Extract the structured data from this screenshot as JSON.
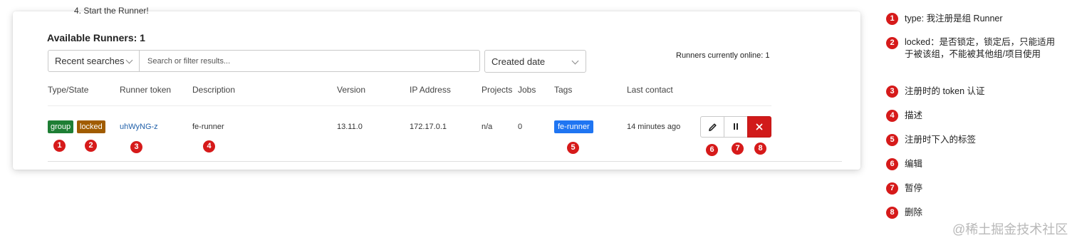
{
  "top_fragment": "4. Start the Runner!",
  "runners_title": "Available Runners: 1",
  "search": {
    "recent_label": "Recent searches",
    "placeholder": "Search or filter results...",
    "sort_label": "Created date"
  },
  "online_text": "Runners currently online: 1",
  "columns": [
    "Type/State",
    "Runner token",
    "Description",
    "Version",
    "IP Address",
    "Projects",
    "Jobs",
    "Tags",
    "Last contact"
  ],
  "runner": {
    "type_badge": "group",
    "state_badge": "locked",
    "token": "uhWyNG-z",
    "description": "fe-runner",
    "version": "13.11.0",
    "ip": "172.17.0.1",
    "projects": "n/a",
    "jobs": "0",
    "tag": "fe-runner",
    "last_contact": "14 minutes ago"
  },
  "actions": {
    "edit_icon": "pencil-icon",
    "pause_icon": "pause-icon",
    "delete_icon": "close-icon"
  },
  "markers": [
    "1",
    "2",
    "3",
    "4",
    "5",
    "6",
    "7",
    "8"
  ],
  "legend": [
    {
      "num": "1",
      "text": "type: 我注册是组 Runner"
    },
    {
      "num": "2",
      "text": "locked：是否锁定，锁定后，只能适用于被该组，不能被其他组/项目使用"
    },
    {
      "num": "3",
      "text": "注册时的 token 认证"
    },
    {
      "num": "4",
      "text": "描述"
    },
    {
      "num": "5",
      "text": "注册时下入的标签"
    },
    {
      "num": "6",
      "text": "编辑"
    },
    {
      "num": "7",
      "text": "暂停"
    },
    {
      "num": "8",
      "text": "删除"
    }
  ],
  "watermark": "@稀土掘金技术社区",
  "colors": {
    "group": "#1e7e34",
    "locked": "#a15c00",
    "tag": "#1f75f2",
    "delete": "#d11a1a",
    "marker": "#d61a1a"
  }
}
